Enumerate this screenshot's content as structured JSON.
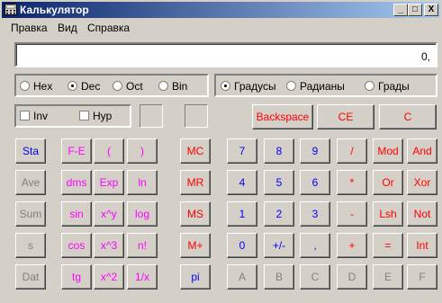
{
  "window": {
    "title": "Калькулятор",
    "min_label": "_",
    "max_label": "□",
    "close_label": "X"
  },
  "menu": {
    "edit": "Правка",
    "view": "Вид",
    "help": "Справка"
  },
  "display": {
    "value": "0,"
  },
  "number_system": [
    {
      "label": "Hex",
      "selected": false
    },
    {
      "label": "Dec",
      "selected": true
    },
    {
      "label": "Oct",
      "selected": false
    },
    {
      "label": "Bin",
      "selected": false
    }
  ],
  "angle_units": [
    {
      "label": "Градусы",
      "selected": true
    },
    {
      "label": "Радианы",
      "selected": false
    },
    {
      "label": "Грады",
      "selected": false
    }
  ],
  "modifiers": {
    "inv": "Inv",
    "hyp": "Hyp"
  },
  "edit_buttons": {
    "backspace": "Backspace",
    "ce": "CE",
    "c": "C"
  },
  "stats_buttons": [
    "Sta",
    "Ave",
    "Sum",
    "s",
    "Dat"
  ],
  "sci_buttons": [
    [
      "F-E",
      "(",
      ")"
    ],
    [
      "dms",
      "Exp",
      "ln"
    ],
    [
      "sin",
      "x^y",
      "log"
    ],
    [
      "cos",
      "x^3",
      "n!"
    ],
    [
      "tg",
      "x^2",
      "1/x"
    ]
  ],
  "mem_buttons": [
    "MC",
    "MR",
    "MS",
    "M+",
    "pi"
  ],
  "main_buttons": [
    [
      "7",
      "8",
      "9",
      "/",
      "Mod",
      "And"
    ],
    [
      "4",
      "5",
      "6",
      "*",
      "Or",
      "Xor"
    ],
    [
      "1",
      "2",
      "3",
      "-",
      "Lsh",
      "Not"
    ],
    [
      "0",
      "+/-",
      ",",
      "+",
      "=",
      "Int"
    ],
    [
      "A",
      "B",
      "C",
      "D",
      "E",
      "F"
    ]
  ],
  "colors": {
    "title_start": "#0a246a",
    "title_end": "#a6caf0",
    "face": "#d4d0c8",
    "blue": "#0000ff",
    "red": "#ff0000",
    "magenta": "#ff00ff",
    "disabled": "#808080"
  }
}
